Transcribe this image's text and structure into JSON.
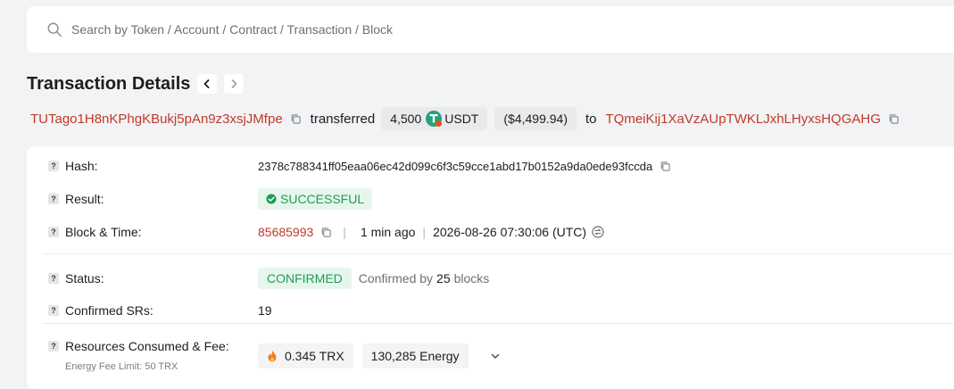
{
  "search": {
    "placeholder": "Search by Token / Account / Contract / Transaction / Block"
  },
  "header": {
    "title": "Transaction Details"
  },
  "summary": {
    "from_address": "TUTago1H8nKPhgKBukj5pAn9z3xsjJMfpe",
    "verb": "transferred",
    "amount": "4,500",
    "token": "USDT",
    "usd_value": "($4,499.94)",
    "to_word": "to",
    "to_address": "TQmeiKij1XaVzAUpTWKLJxhLHyxsHQGAHG"
  },
  "details": {
    "hash_label": "Hash:",
    "hash_value": "2378c788341ff05eaa06ec42d099c6f3c59cce1abd17b0152a9da0ede93fccda",
    "result_label": "Result:",
    "result_value": "SUCCESSFUL",
    "block_label": "Block & Time:",
    "block_number": "85685993",
    "block_age": "1 min ago",
    "block_time": "2026-08-26 07:30:06 (UTC)",
    "status_label": "Status:",
    "status_value": "CONFIRMED",
    "confirmed_by_prefix": "Confirmed by",
    "confirmed_by_count": "25",
    "confirmed_by_suffix": "blocks",
    "srs_label": "Confirmed SRs:",
    "srs_value": "19",
    "resources_label": "Resources Consumed & Fee:",
    "fee_limit": "Energy Fee Limit: 50 TRX",
    "trx_fee": "0.345 TRX",
    "energy": "130,285 Energy"
  },
  "colors": {
    "address": "#c0392b",
    "success": "#1f9d55",
    "tether": "#26a17b"
  }
}
